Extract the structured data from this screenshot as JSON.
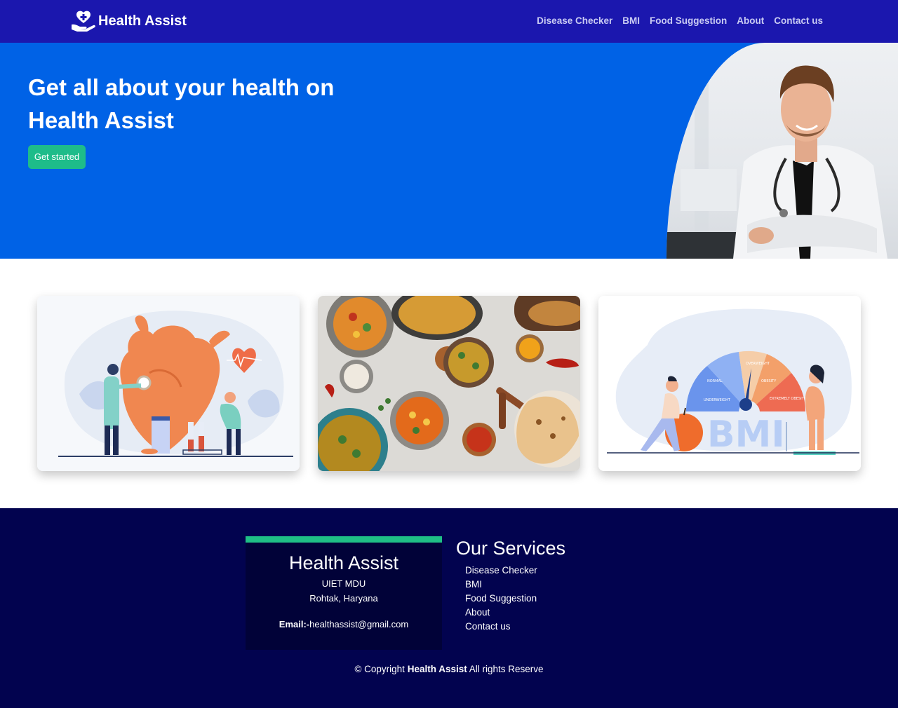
{
  "nav": {
    "brand": "Health Assist",
    "links": [
      "Disease Checker",
      "BMI",
      "Food Suggestion",
      "About",
      "Contact us"
    ]
  },
  "hero": {
    "title": "Get all about your health on Health Assist",
    "button": "Get started"
  },
  "cards": [
    {
      "image": "heart-health-illustration"
    },
    {
      "image": "indian-food-photo"
    },
    {
      "image": "bmi-illustration",
      "labels": [
        "UNDERWEIGHT",
        "NORMAL",
        "OVERWEIGHT",
        "OBESITY",
        "EXTREMELY OBESITY"
      ],
      "big_text": "BMI"
    }
  ],
  "footer": {
    "title": "Health Assist",
    "address_line1": "UIET MDU",
    "address_line2": "Rohtak, Haryana",
    "email_label": "Email:-",
    "email": "healthassist@gmail.com",
    "services_title": "Our Services",
    "services": [
      "Disease Checker",
      "BMI",
      "Food Suggestion",
      "About",
      "Contact us"
    ],
    "copyright_prefix": "© Copyright",
    "copyright_brand": "Health Assist",
    "copyright_suffix": "All rights Reserve"
  },
  "colors": {
    "navbar": "#1b17ae",
    "hero": "#0062e6",
    "button": "#1ebc8a",
    "footer": "#02034f",
    "footer_box": "#010238",
    "accent": "#1fbf86"
  }
}
